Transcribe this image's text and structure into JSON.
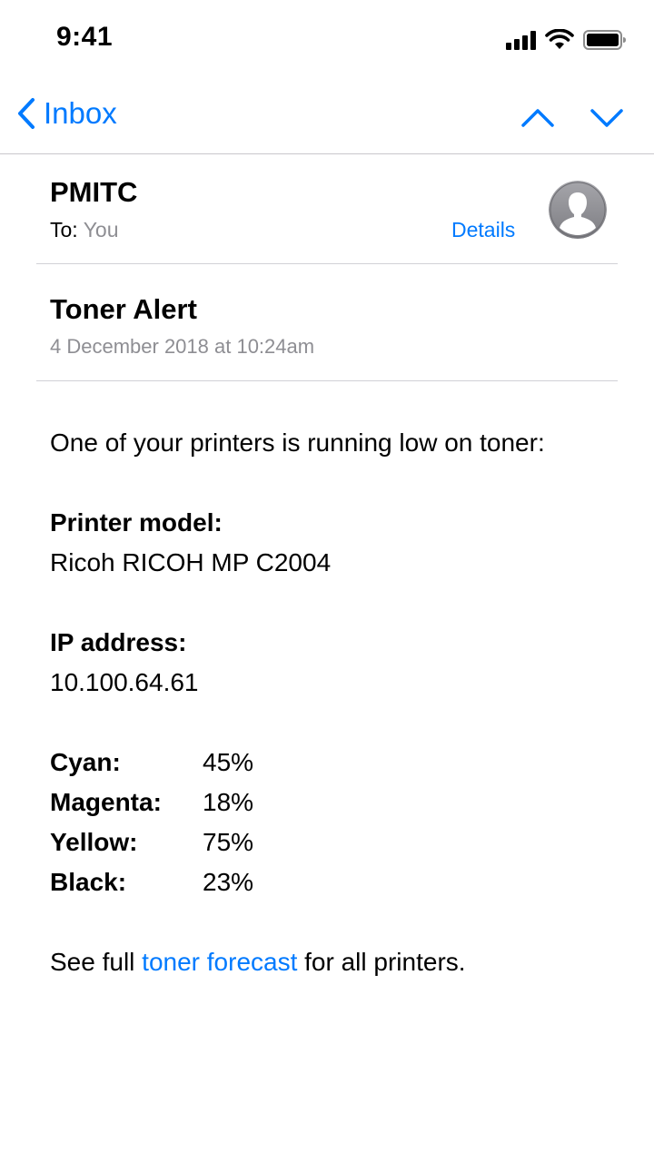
{
  "status_bar": {
    "time": "9:41",
    "icons": [
      "signal-icon",
      "wifi-icon",
      "battery-icon"
    ]
  },
  "nav": {
    "back_label": "Inbox",
    "icons": [
      "chevron-left-icon",
      "chevron-up-icon",
      "chevron-down-icon"
    ]
  },
  "header": {
    "sender": "PMITC",
    "to_label": "To:",
    "to_value": "You",
    "details_label": "Details",
    "avatar_icon": "person-icon"
  },
  "message": {
    "subject": "Toner Alert",
    "date": "4 December 2018 at 10:24am"
  },
  "body": {
    "intro": "One of your printers is running low on toner:",
    "printer_model_label": "Printer model:",
    "printer_model_value": "Ricoh RICOH MP C2004",
    "ip_label": "IP address:",
    "ip_value": "10.100.64.61",
    "toner_levels": [
      {
        "name": "Cyan:",
        "value": "45%"
      },
      {
        "name": "Magenta:",
        "value": "18%"
      },
      {
        "name": "Yellow:",
        "value": "75%"
      },
      {
        "name": "Black:",
        "value": "23%"
      }
    ],
    "footer_prefix": "See full ",
    "footer_link": "toner forecast",
    "footer_suffix": " for all printers."
  },
  "colors": {
    "accent": "#007aff",
    "secondary_text": "#8e8e93",
    "separator": "#d1d1d6"
  }
}
